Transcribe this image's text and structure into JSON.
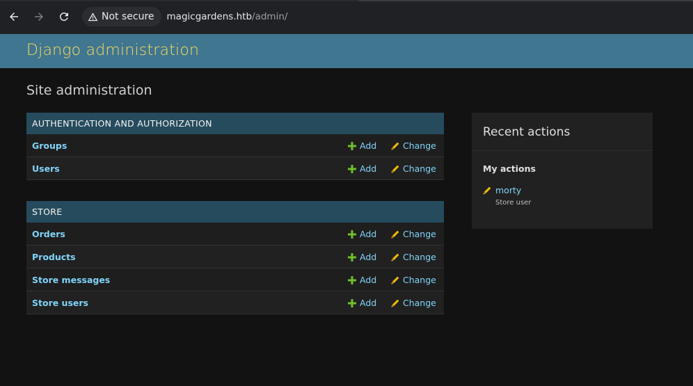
{
  "browser": {
    "security_label": "Not secure",
    "url_host": "magicgardens.htb",
    "url_path": "/admin/"
  },
  "header": {
    "branding": "Django administration"
  },
  "page": {
    "title": "Site administration"
  },
  "modules": [
    {
      "caption": "AUTHENTICATION AND AUTHORIZATION",
      "models": [
        {
          "name": "Groups",
          "add": "Add",
          "change": "Change"
        },
        {
          "name": "Users",
          "add": "Add",
          "change": "Change"
        }
      ]
    },
    {
      "caption": "STORE",
      "models": [
        {
          "name": "Orders",
          "add": "Add",
          "change": "Change"
        },
        {
          "name": "Products",
          "add": "Add",
          "change": "Change"
        },
        {
          "name": "Store messages",
          "add": "Add",
          "change": "Change"
        },
        {
          "name": "Store users",
          "add": "Add",
          "change": "Change"
        }
      ]
    }
  ],
  "recent_actions": {
    "title": "Recent actions",
    "subtitle": "My actions",
    "items": [
      {
        "label": "morty",
        "type": "Store user"
      }
    ]
  },
  "colors": {
    "header_bg": "#417690",
    "branding": "#f5dd5d",
    "caption_bg": "#264b5d",
    "link": "#81d4fa",
    "add_icon": "#70bf2b",
    "change_icon": "#efb80b"
  },
  "icons": {
    "back": "arrow-left-icon",
    "forward": "arrow-right-icon",
    "reload": "reload-icon",
    "security": "warning-triangle-icon",
    "add": "plus-icon",
    "change": "pencil-icon"
  }
}
